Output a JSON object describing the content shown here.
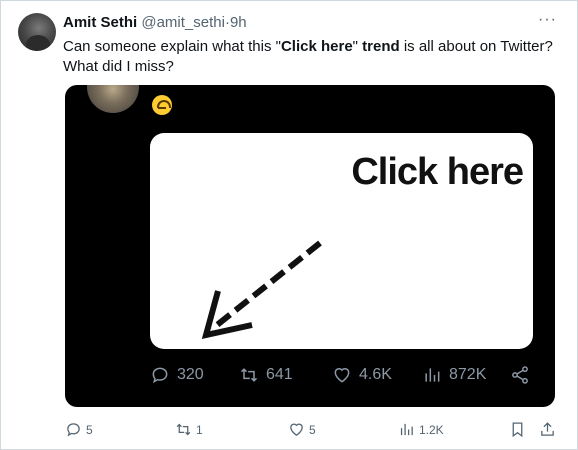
{
  "tweet": {
    "author_name": "Amit Sethi",
    "author_handle": "@amit_sethi",
    "separator": "·",
    "time": "9h",
    "text_prefix": "Can someone explain what this \"",
    "text_bold_1": "Click here",
    "text_mid": "\" ",
    "text_bold_2": "trend",
    "text_suffix": " is all about on Twitter? What did I miss?",
    "more": "···"
  },
  "media": {
    "card_text": "Click here",
    "actions": {
      "replies": "320",
      "reposts": "641",
      "likes": "4.6K",
      "views": "872K"
    }
  },
  "actions": {
    "replies": "5",
    "reposts": "1",
    "likes": "5",
    "views": "1.2K"
  },
  "icons": {
    "reply": "reply-icon",
    "repost": "repost-icon",
    "like": "heart-icon",
    "views": "views-icon",
    "share": "share-icon",
    "bookmark": "bookmark-icon",
    "emoji": "upside-down-face-icon"
  },
  "colors": {
    "text": "#0f1419",
    "muted": "#536471",
    "media_bg": "#000000",
    "media_muted": "#8b98a5"
  }
}
